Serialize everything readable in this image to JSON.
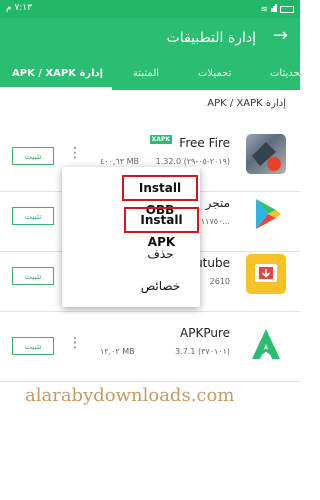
{
  "status": {
    "time": "٧:١٣ م"
  },
  "header": {
    "title": "إدارة التطبيقات",
    "back_icon": "arrow-right-icon"
  },
  "tabs": [
    {
      "label": "APK / XAPK إدارة",
      "active": true
    },
    {
      "label": "المثبتة",
      "active": false
    },
    {
      "label": "تحميلات",
      "active": false
    },
    {
      "label": "تحديثات",
      "active": false
    }
  ],
  "section_title": "APK / XAPK إدارة",
  "install_label": "تثبيت",
  "apps": [
    {
      "name": "Free Fire",
      "badge": "XAPK",
      "version": "1.32.0 (٢٠١٩-٠٥-٢٩)",
      "size": "٤٠٠,٦٣ MB",
      "icon": "free-fire-icon"
    },
    {
      "name": "متجر",
      "version": "١١٧٥٠...",
      "size": "",
      "icon": "play-store-icon"
    },
    {
      "name": "utube",
      "version": "2610",
      "size": "",
      "icon": "video-download-icon"
    },
    {
      "name": "APKPure",
      "version": "3.7.1 (٣٧٠١٠١)",
      "size": "١٢,٠٢ MB",
      "icon": "apkpure-icon"
    }
  ],
  "menu": {
    "install_obb": "Install OBB",
    "install_apk": "Install APK",
    "delete": "حذف",
    "properties": "خصائص"
  },
  "watermark": "alarabydownloads.com",
  "colors": {
    "primary": "#2bbd72",
    "highlight": "#d2171e"
  }
}
